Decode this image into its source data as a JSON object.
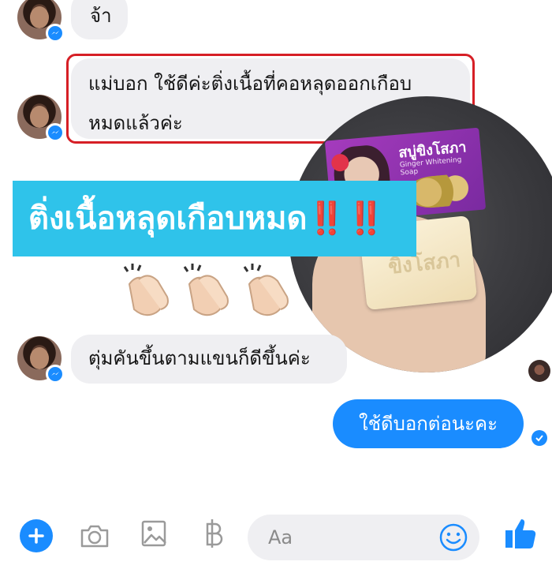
{
  "messages": {
    "incoming_1": "จ้า",
    "incoming_2_line1": "แม่บอก ใช้ดีค่ะติ่งเนื้อที่คอหลุดออกเกือบ",
    "incoming_2_line2": "หมดแล้วค่ะ",
    "incoming_3": "ตุ่มคันขึ้นตามแขนก็ดีขึ้นค่ะ",
    "outgoing_1": "ใช้ดีบอกต่อนะคะ"
  },
  "banner": {
    "text": "ติ่งเนื้อหลุดเกือบหมด",
    "bangs": "‼️‼️"
  },
  "product": {
    "brand": "สบู่ขิงโสภา",
    "subtitle": "Ginger Whitening Soap",
    "bar_text": "ขิงโสภา"
  },
  "composer": {
    "placeholder": "Aa",
    "icons": [
      "plus-icon",
      "camera-icon",
      "image-icon",
      "baht-icon",
      "emoji-icon",
      "thumbs-up-icon"
    ]
  },
  "colors": {
    "accent": "#1a8cff",
    "banner": "#2fc3ea",
    "highlight_frame": "#d61f26",
    "bubble_incoming": "#efeff2"
  }
}
